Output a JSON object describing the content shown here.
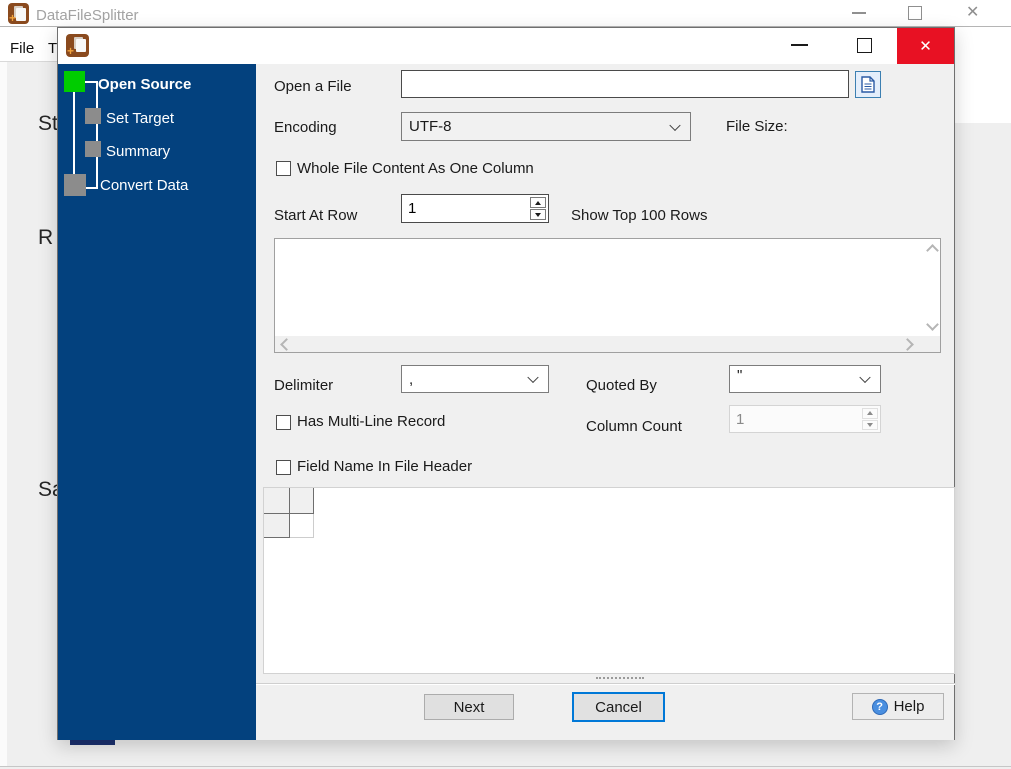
{
  "background_window": {
    "title": "DataFileSplitter",
    "menu_items": [
      "File",
      "T"
    ],
    "partial_labels": [
      "St",
      "R",
      "Sa"
    ],
    "close_glyph": "✕"
  },
  "dialog": {
    "close_glyph": "✕",
    "steps": [
      {
        "label": "Open Source",
        "state": "active"
      },
      {
        "label": "Set Target",
        "state": "pending"
      },
      {
        "label": "Summary",
        "state": "pending"
      },
      {
        "label": "Convert Data",
        "state": "pending"
      }
    ],
    "form": {
      "open_file_label": "Open a File",
      "open_file_value": "",
      "encoding_label": "Encoding",
      "encoding_value": "UTF-8",
      "file_size_label": "File Size:",
      "whole_file_checkbox_label": "Whole File Content As One Column",
      "start_at_row_label": "Start At Row",
      "start_at_row_value": "1",
      "show_top_rows_label": "Show Top 100 Rows",
      "delimiter_label": "Delimiter",
      "delimiter_value": ",",
      "quoted_by_label": "Quoted By",
      "quoted_by_value": "\"",
      "multi_line_checkbox_label": "Has Multi-Line Record",
      "column_count_label": "Column Count",
      "column_count_value": "1",
      "field_name_checkbox_label": "Field Name In File Header"
    },
    "buttons": {
      "next": "Next",
      "cancel": "Cancel",
      "help": "Help",
      "help_icon_glyph": "?"
    },
    "colors": {
      "sidebar": "#03417e",
      "active_step": "#00cc00",
      "pending_step": "#8c8c8c",
      "close_button": "#e81123",
      "focus_border": "#0078d7"
    }
  }
}
